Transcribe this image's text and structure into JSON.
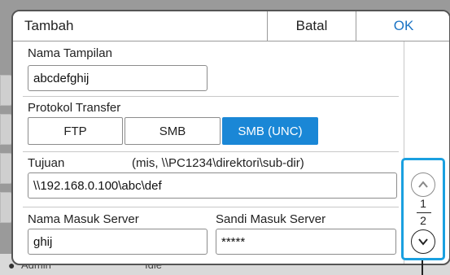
{
  "background": {
    "user_label": "Admin",
    "status_label": "Idle"
  },
  "dialog": {
    "title": "Tambah",
    "cancel_label": "Batal",
    "ok_label": "OK"
  },
  "form": {
    "display_name": {
      "label": "Nama Tampilan",
      "value": "abcdefghij"
    },
    "protocol": {
      "label": "Protokol Transfer",
      "options": [
        "FTP",
        "SMB",
        "SMB (UNC)"
      ],
      "selected": "SMB (UNC)"
    },
    "destination": {
      "label": "Tujuan",
      "hint": "(mis, \\\\PC1234\\direktori\\sub-dir)",
      "value": "\\\\192.168.0.100\\abc\\def"
    },
    "server_login": {
      "label": "Nama Masuk Server",
      "value": "ghij"
    },
    "server_password": {
      "label": "Sandi Masuk Server",
      "value": "*****"
    }
  },
  "pager": {
    "current": "1",
    "total": "2",
    "up_icon": "chevron-up-icon",
    "down_icon": "chevron-down-icon"
  },
  "colors": {
    "accent": "#1a87d6",
    "ok_text": "#1a73c4",
    "highlight_border": "#1aa0e0"
  }
}
